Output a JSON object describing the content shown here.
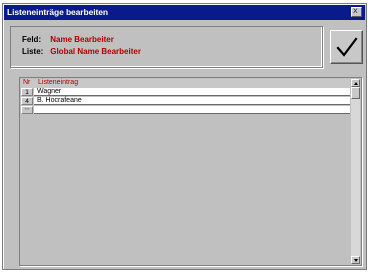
{
  "window": {
    "title": "Listeneinträge bearbeiten",
    "close_glyph": "x"
  },
  "info": {
    "feld_label": "Feld:",
    "feld_value": "Name Bearbeiter",
    "liste_label": "Liste:",
    "liste_value": "Global Name Bearbeiter"
  },
  "ok_button": {
    "icon": "checkmark-icon"
  },
  "list": {
    "columns": {
      "nr": "Nr",
      "bezeichnung": "Listeneintrag"
    },
    "rows": [
      {
        "nr": "1",
        "text": "Wagner"
      },
      {
        "nr": "4",
        "text": "B. Hocrafeane"
      },
      {
        "nr": "**",
        "text": ""
      }
    ]
  },
  "colors": {
    "title_bg": "#0a1a8a",
    "label_red": "#b00000",
    "face": "#c0c0c0"
  }
}
